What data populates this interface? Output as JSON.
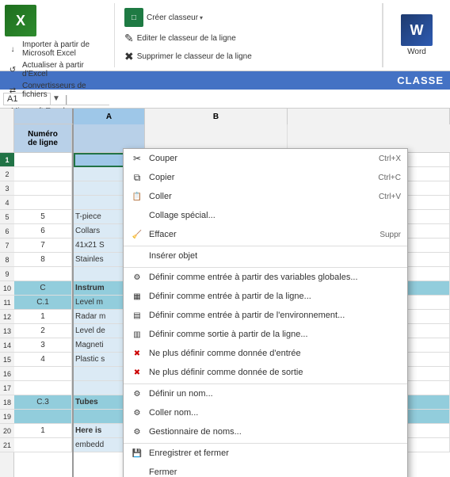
{
  "ribbon": {
    "excel_label": "X",
    "excel_section_label": "Microsoft Excel",
    "buttons_left": [
      {
        "label": "Importer à partir de Microsoft Excel",
        "icon": "↓",
        "has_icon": true
      },
      {
        "label": "Actualiser à partir d'Excel",
        "icon": "↺",
        "has_icon": true
      },
      {
        "label": "Convertisseurs de fichiers",
        "icon": "⇄",
        "has_icon": true
      }
    ],
    "buttons_center_top": [
      {
        "label": "Créer classeur",
        "icon": "□",
        "has_dropdown": true
      },
      {
        "label": "Créer",
        "icon": "□"
      }
    ],
    "buttons_center_mid": [
      {
        "label": "Editer le classeur de la ligne",
        "icon": "✎"
      },
      {
        "label": "Editer",
        "icon": "✎"
      }
    ],
    "buttons_center_bot": [
      {
        "label": "Supprimer le classeur de la ligne",
        "icon": "✖"
      },
      {
        "label": "Su",
        "icon": "✖"
      }
    ],
    "word_label": "Word",
    "word_icon": "W",
    "section_label": "Microsoft Excel"
  },
  "title_bar": {
    "text": "CLASSE"
  },
  "formula_bar": {
    "cell_ref": "A1",
    "formula": ""
  },
  "col_headers": [
    "A",
    "B"
  ],
  "frozen_header": {
    "line1": "Numéro",
    "line2": "de ligne"
  },
  "row_numbers": [
    1,
    2,
    3,
    4,
    5,
    6,
    7,
    8,
    9,
    10,
    11,
    12,
    13,
    14,
    15,
    16,
    17,
    18,
    19,
    20,
    21
  ],
  "grid_data": [
    {
      "row": 1,
      "col_a": "",
      "col_b": "",
      "style_a": "active-cell",
      "style_b": "selected-col",
      "num": ""
    },
    {
      "row": 2,
      "col_a": "",
      "col_b": "",
      "style_a": "selected-col",
      "style_b": "selected-col",
      "num": ""
    },
    {
      "row": 3,
      "col_a": "",
      "col_b": "",
      "style_a": "selected-col",
      "style_b": "selected-col",
      "num": ""
    },
    {
      "row": 4,
      "col_a": "",
      "col_b": "",
      "style_a": "selected-col",
      "style_b": "selected-col",
      "num": ""
    },
    {
      "row": 5,
      "col_a": "T-piece",
      "col_b": "",
      "style_a": "selected-col",
      "style_b": "",
      "num": "5",
      "num_style": ""
    },
    {
      "row": 6,
      "col_a": "Collars",
      "col_b": "",
      "style_a": "selected-col",
      "style_b": "",
      "num": "6",
      "num_style": ""
    },
    {
      "row": 7,
      "col_a": "41x21 S",
      "col_b": "",
      "style_a": "selected-col",
      "style_b": "",
      "num": "7",
      "num_style": ""
    },
    {
      "row": 8,
      "col_a": "Stainles",
      "col_b": "",
      "style_a": "selected-col",
      "style_b": "",
      "num": "8",
      "num_style": ""
    },
    {
      "row": 9,
      "col_a": "",
      "col_b": "",
      "style_a": "selected-col",
      "style_b": "",
      "num": "",
      "num_style": ""
    },
    {
      "row": 10,
      "col_a": "",
      "col_b": "",
      "style_a": "selected-col",
      "style_b": "",
      "num": "C",
      "num_style": "teal-bg bold-text"
    },
    {
      "row": 11,
      "col_a": "Instrum",
      "col_b": "",
      "style_a": "selected-col teal-bg bold-text",
      "style_b": "teal-bg",
      "num": "C.1",
      "num_style": "teal-bg"
    },
    {
      "row": 12,
      "col_a": "Level m",
      "col_b": "",
      "style_a": "selected-col",
      "style_b": "",
      "num": "1",
      "num_style": ""
    },
    {
      "row": 13,
      "col_a": "Radar m",
      "col_b": "",
      "style_a": "selected-col",
      "style_b": "",
      "num": "2",
      "num_style": ""
    },
    {
      "row": 14,
      "col_a": "Level de",
      "col_b": "",
      "style_a": "selected-col",
      "style_b": "",
      "num": "3",
      "num_style": ""
    },
    {
      "row": 15,
      "col_a": "Magneti",
      "col_b": "",
      "style_a": "selected-col",
      "style_b": "",
      "num": "4",
      "num_style": ""
    },
    {
      "row": 16,
      "col_a": "Plastic s",
      "col_b": "",
      "style_a": "selected-col",
      "style_b": "",
      "num": "",
      "num_style": ""
    },
    {
      "row": 17,
      "col_a": "",
      "col_b": "",
      "style_a": "selected-col",
      "style_b": "",
      "num": "",
      "num_style": ""
    },
    {
      "row": 18,
      "col_a": "",
      "col_b": "",
      "style_a": "selected-col teal-bg",
      "style_b": "teal-bg",
      "num": "C.3",
      "num_style": "teal-bg"
    },
    {
      "row": 19,
      "col_a": "Tubes",
      "col_b": "",
      "style_a": "selected-col teal-bg",
      "style_b": "teal-bg",
      "num": "",
      "num_style": "teal-bg"
    },
    {
      "row": 20,
      "col_a": "Here is",
      "col_b": "",
      "style_a": "selected-col bold-text",
      "style_b": "",
      "num": "1",
      "num_style": ""
    },
    {
      "row": 21,
      "col_a": "embedd",
      "col_b": "",
      "style_a": "selected-col",
      "style_b": "",
      "num": "",
      "num_style": ""
    }
  ],
  "frozen_rows": [
    {
      "val": "",
      "style": ""
    },
    {
      "val": "",
      "style": ""
    },
    {
      "val": "",
      "style": ""
    },
    {
      "val": "",
      "style": ""
    },
    {
      "val": "5",
      "style": ""
    },
    {
      "val": "6",
      "style": ""
    },
    {
      "val": "7",
      "style": ""
    },
    {
      "val": "8",
      "style": ""
    },
    {
      "val": "",
      "style": ""
    },
    {
      "val": "C",
      "style": "teal-bg bold-text"
    },
    {
      "val": "C.1",
      "style": "teal-bg"
    },
    {
      "val": "1",
      "style": ""
    },
    {
      "val": "2",
      "style": ""
    },
    {
      "val": "3",
      "style": ""
    },
    {
      "val": "4",
      "style": ""
    },
    {
      "val": "",
      "style": ""
    },
    {
      "val": "",
      "style": ""
    },
    {
      "val": "C.3",
      "style": "teal-bg"
    },
    {
      "val": "",
      "style": "teal-bg"
    },
    {
      "val": "1",
      "style": ""
    },
    {
      "val": "",
      "style": ""
    }
  ],
  "context_menu": {
    "items": [
      {
        "label": "Couper",
        "shortcut": "Ctrl+X",
        "icon": "✂",
        "separator": false,
        "disabled": false
      },
      {
        "label": "Copier",
        "shortcut": "Ctrl+C",
        "icon": "⧉",
        "separator": false,
        "disabled": false
      },
      {
        "label": "Coller",
        "shortcut": "Ctrl+V",
        "icon": "📋",
        "separator": false,
        "disabled": false
      },
      {
        "label": "Collage spécial...",
        "shortcut": "",
        "icon": "",
        "separator": false,
        "disabled": false
      },
      {
        "label": "Effacer",
        "shortcut": "Suppr",
        "icon": "🧹",
        "separator": false,
        "disabled": false
      },
      {
        "label": "Insérer objet",
        "shortcut": "",
        "icon": "",
        "separator": true,
        "disabled": false
      },
      {
        "label": "Définir comme entrée à partir des variables globales...",
        "shortcut": "",
        "icon": "⚙",
        "separator": true,
        "disabled": false
      },
      {
        "label": "Définir comme entrée à partir de la ligne...",
        "shortcut": "",
        "icon": "▦",
        "separator": false,
        "disabled": false
      },
      {
        "label": "Définir comme entrée à partir de l'environnement...",
        "shortcut": "",
        "icon": "▤",
        "separator": false,
        "disabled": false
      },
      {
        "label": "Définir comme sortie à partir de la ligne...",
        "shortcut": "",
        "icon": "▥",
        "separator": false,
        "disabled": false
      },
      {
        "label": "Ne plus définir comme donnée d'entrée",
        "shortcut": "",
        "icon": "✖",
        "separator": false,
        "disabled": false
      },
      {
        "label": "Ne plus définir comme donnée de sortie",
        "shortcut": "",
        "icon": "✖",
        "separator": false,
        "disabled": false
      },
      {
        "label": "Définir un nom...",
        "shortcut": "",
        "icon": "⚙",
        "separator": true,
        "disabled": false
      },
      {
        "label": "Coller nom...",
        "shortcut": "",
        "icon": "⚙",
        "separator": false,
        "disabled": false
      },
      {
        "label": "Gestionnaire de noms...",
        "shortcut": "",
        "icon": "⚙",
        "separator": false,
        "disabled": false
      },
      {
        "label": "Enregistrer et fermer",
        "shortcut": "",
        "icon": "💾",
        "separator": true,
        "disabled": false
      },
      {
        "label": "Fermer",
        "shortcut": "",
        "icon": "",
        "separator": false,
        "disabled": false
      }
    ]
  }
}
